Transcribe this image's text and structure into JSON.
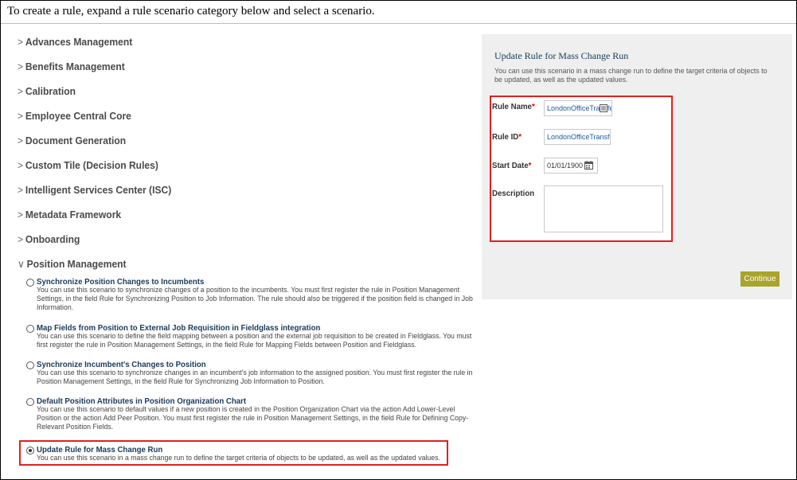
{
  "intro": "To create a rule, expand a rule scenario category below and select a scenario.",
  "categories": [
    {
      "label": "Advances Management",
      "expanded": false
    },
    {
      "label": "Benefits Management",
      "expanded": false
    },
    {
      "label": "Calibration",
      "expanded": false
    },
    {
      "label": "Employee Central Core",
      "expanded": false
    },
    {
      "label": "Document Generation",
      "expanded": false
    },
    {
      "label": "Custom Tile (Decision Rules)",
      "expanded": false
    },
    {
      "label": "Intelligent Services Center (ISC)",
      "expanded": false
    },
    {
      "label": "Metadata Framework",
      "expanded": false
    },
    {
      "label": "Onboarding",
      "expanded": false
    },
    {
      "label": "Position Management",
      "expanded": true
    }
  ],
  "chevrons": {
    "collapsed": ">",
    "expanded": "∨"
  },
  "scenarios": [
    {
      "title": "Synchronize Position Changes to Incumbents",
      "description": "You can use this scenario to synchronize changes of a position to the incumbents. You must first register the rule in Position Management Settings, in the field Rule for Synchronizing Position to Job Information. The rule should also be triggered if the position field is changed in Job Information.",
      "selected": false
    },
    {
      "title": "Map Fields from Position to External Job Requisition in Fieldglass integration",
      "description": "You can use this scenario to define the field mapping between a position and the external job requisition to be created in Fieldglass. You must first register the rule in Position Management Settings, in the field Rule for Mapping Fields between Position and Fieldglass.",
      "selected": false
    },
    {
      "title": "Synchronize Incumbent's Changes to Position",
      "description": "You can use this scenario to synchronize changes in an incumbent's job information to the assigned position. You must first register the rule in Position Management Settings, in the field Rule for Synchronizing Job Information to Position.",
      "selected": false
    },
    {
      "title": "Default Position Attributes in Position Organization Chart",
      "description": "You can use this scenario to default values if a new position is created in the Position Organization Chart via the action Add Lower-Level Position or the action Add Peer Position. You must first register the rule in Position Management Settings, in the field Rule for Defining Copy-Relevant Position Fields.",
      "selected": false
    },
    {
      "title": "Update Rule for Mass Change Run",
      "description": "You can use this scenario in a mass change run to define the target criteria of objects to be updated, as well as the updated values.",
      "selected": true
    }
  ],
  "panel": {
    "title": "Update Rule for Mass Change Run",
    "description": "You can use this scenario in a mass change run to define the target criteria of objects to be updated, as well as the updated values.",
    "rule_name_label": "Rule Name",
    "rule_name_value": "LondonOfficeTransfe",
    "rule_id_label": "Rule ID",
    "rule_id_value": "LondonOfficeTransfer",
    "start_date_label": "Start Date",
    "start_date_value": "01/01/1900",
    "description_label": "Description",
    "description_value": "",
    "required_marker": "*",
    "continue_label": "Continue"
  },
  "icons": {
    "translation": "translate-icon",
    "calendar": "calendar-icon"
  },
  "colors": {
    "continue_button": "#a9a42c",
    "highlight_border": "#e02020",
    "link_title": "#1a3a5c",
    "required": "#d00000"
  }
}
